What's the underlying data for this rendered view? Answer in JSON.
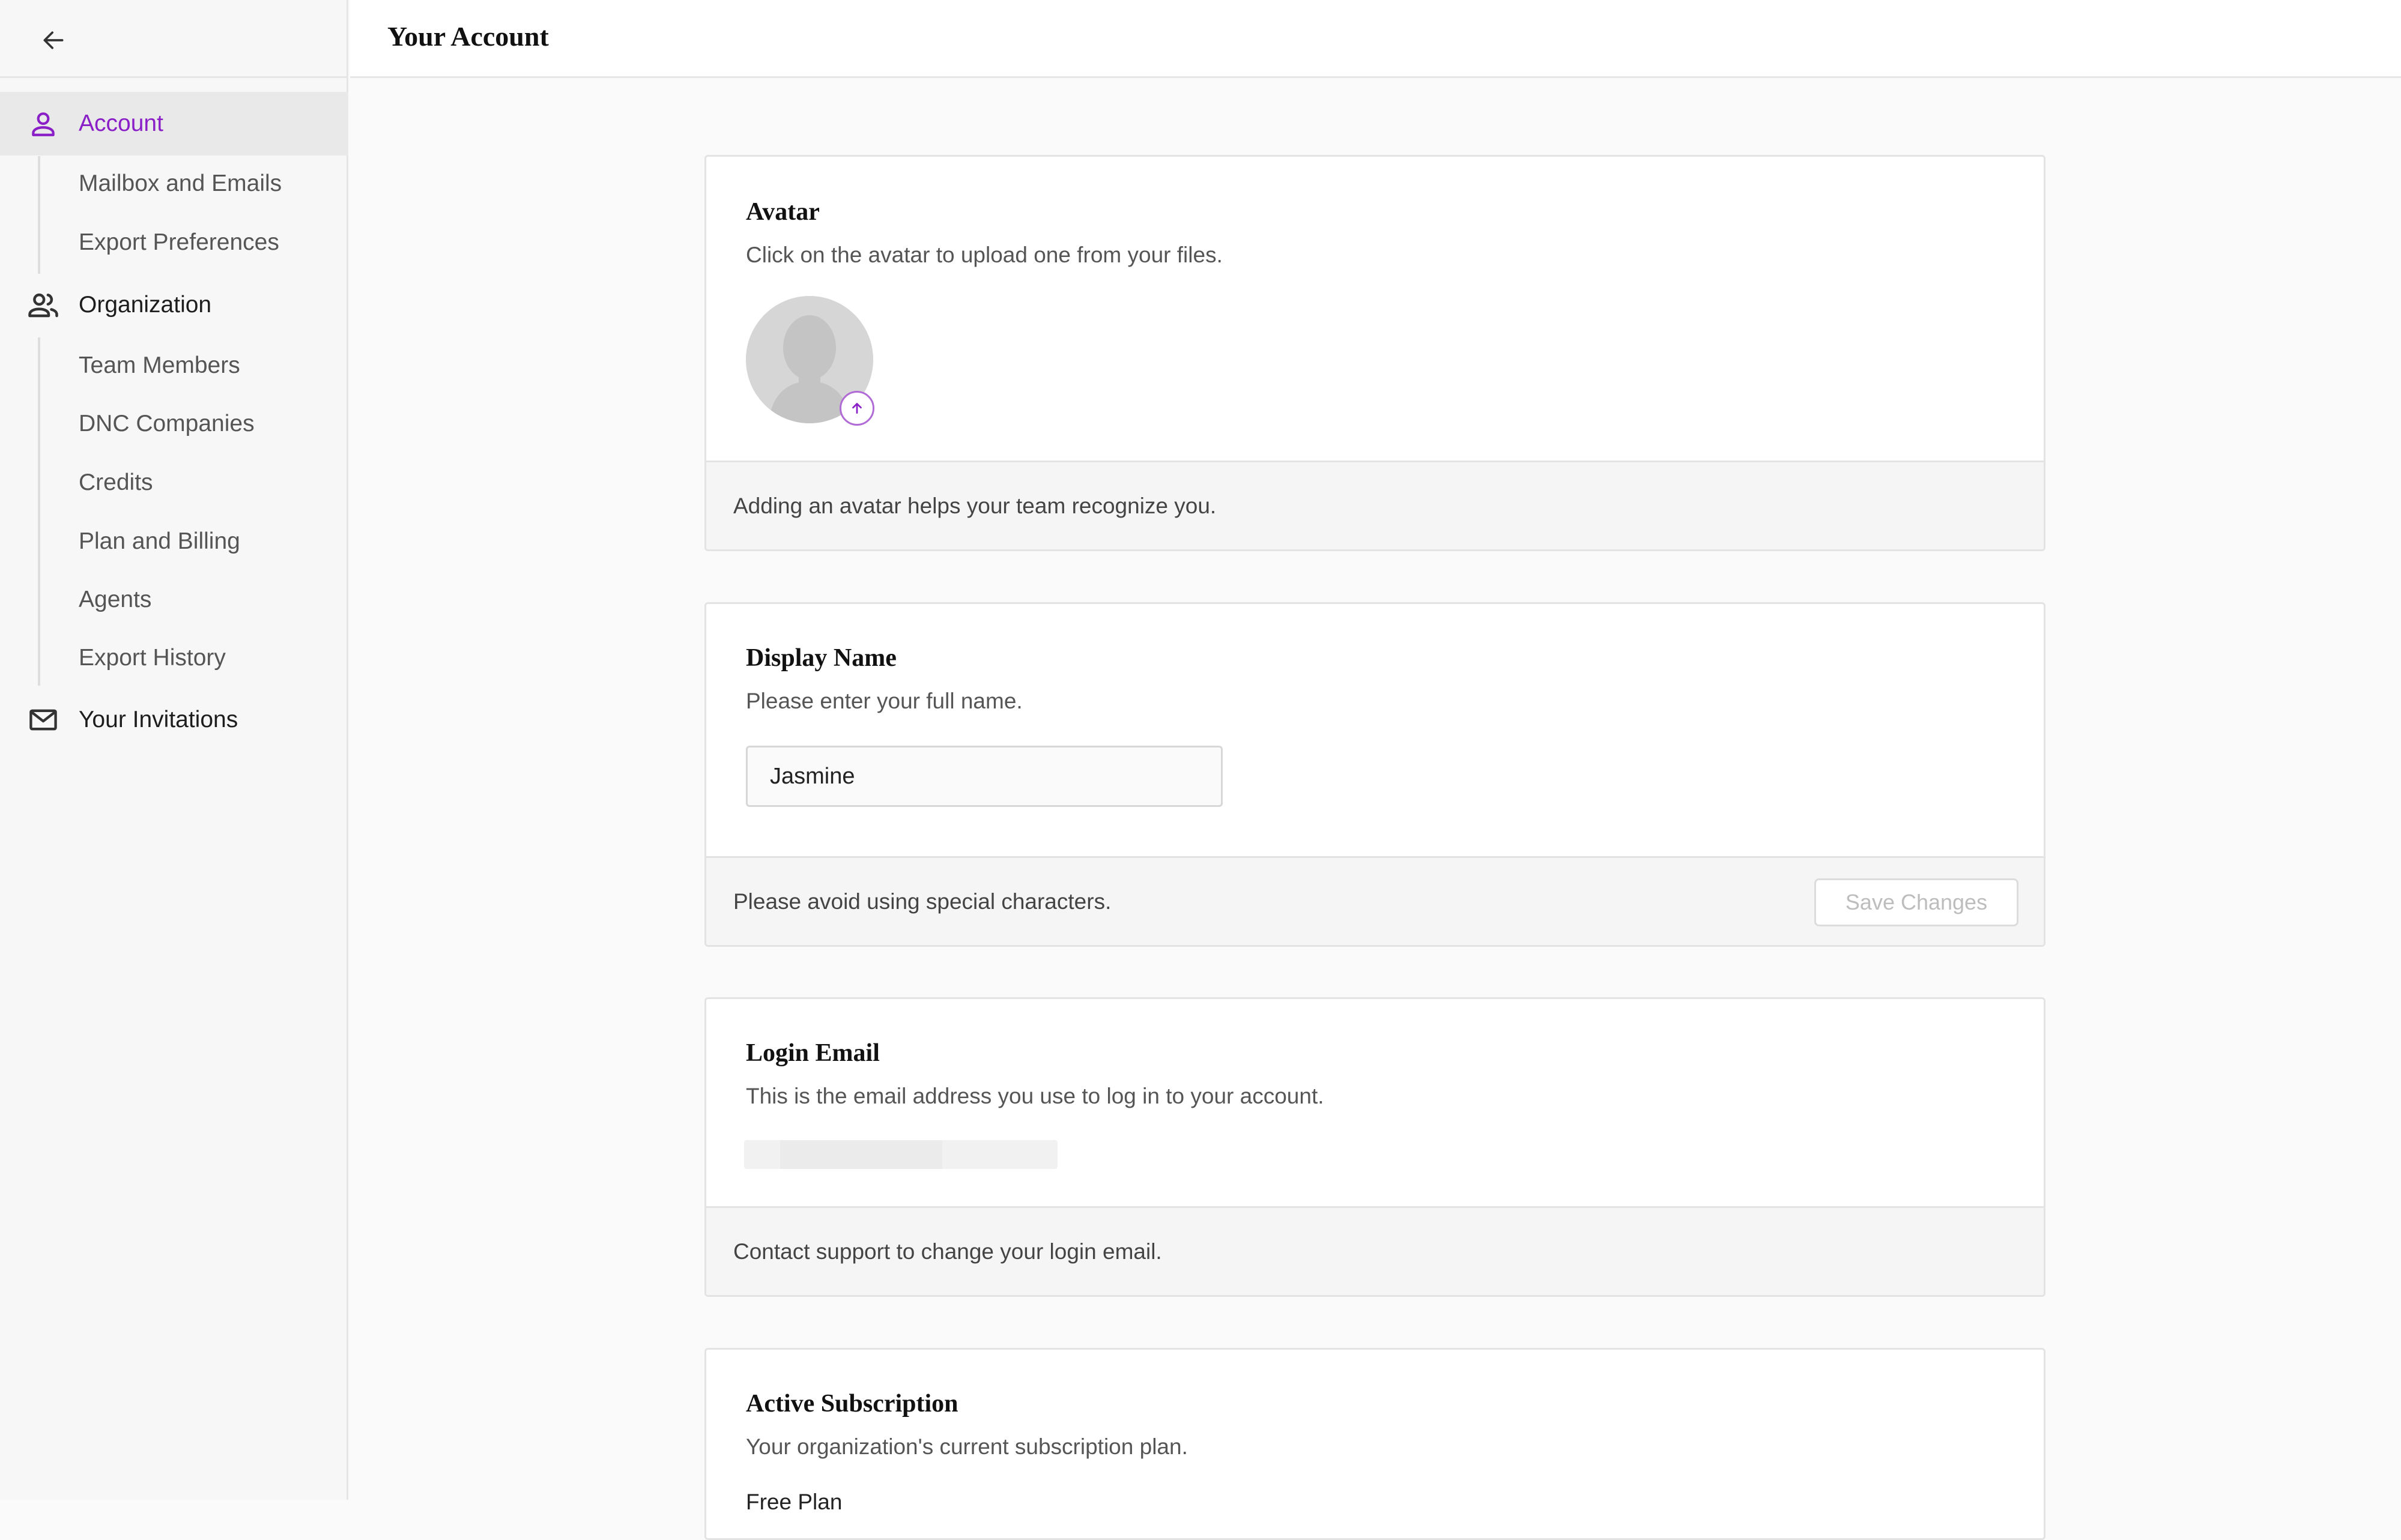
{
  "header": {
    "title": "Your Account"
  },
  "sidebar": {
    "back_icon": "arrow-left-icon",
    "sections": [
      {
        "label": "Account",
        "icon": "person-icon",
        "active": true,
        "children": [
          {
            "label": "Mailbox and Emails"
          },
          {
            "label": "Export Preferences"
          }
        ]
      },
      {
        "label": "Organization",
        "icon": "people-icon",
        "children": [
          {
            "label": "Team Members"
          },
          {
            "label": "DNC Companies"
          },
          {
            "label": "Credits"
          },
          {
            "label": "Plan and Billing"
          },
          {
            "label": "Agents"
          },
          {
            "label": "Export History"
          }
        ]
      },
      {
        "label": "Your Invitations",
        "icon": "envelope-icon",
        "children": []
      }
    ]
  },
  "cards": {
    "avatar": {
      "title": "Avatar",
      "description": "Click on the avatar to upload one from your files.",
      "footer": "Adding an avatar helps your team recognize you."
    },
    "display_name": {
      "title": "Display Name",
      "description": "Please enter your full name.",
      "input_value": "Jasmine",
      "footer": "Please avoid using special characters.",
      "save_label": "Save Changes"
    },
    "login_email": {
      "title": "Login Email",
      "description": "This is the email address you use to log in to your account.",
      "footer": "Contact support to change your login email."
    },
    "subscription": {
      "title": "Active Subscription",
      "description": "Your organization's current subscription plan.",
      "plan": "Free Plan"
    }
  },
  "colors": {
    "accent": "#8a1fc7",
    "sidebar_bg": "#f7f7f7",
    "active_bg": "#e9e9e9"
  }
}
